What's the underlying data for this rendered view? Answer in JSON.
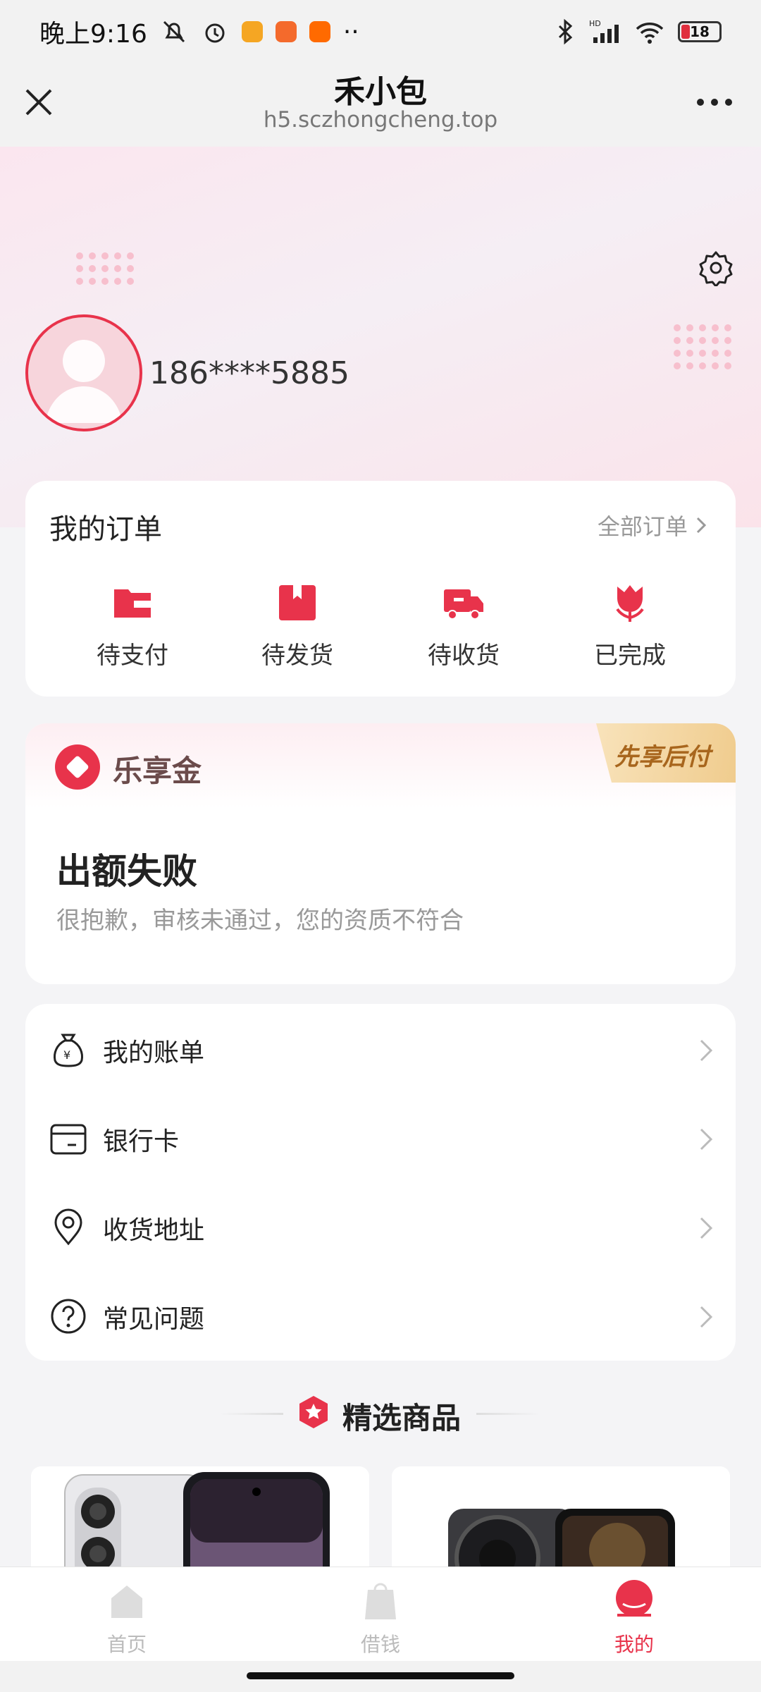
{
  "status_bar": {
    "time": "晚上9:16",
    "network": "HD",
    "battery": "18"
  },
  "nav": {
    "title": "禾小包",
    "url": "h5.sczhongcheng.top"
  },
  "profile": {
    "phone": "186****5885"
  },
  "orders": {
    "title": "我的订单",
    "all_link": "全部订单",
    "items": [
      {
        "label": "待支付",
        "icon": "wallet-icon"
      },
      {
        "label": "待发货",
        "icon": "bookmark-box-icon"
      },
      {
        "label": "待收货",
        "icon": "truck-icon"
      },
      {
        "label": "已完成",
        "icon": "tulip-icon"
      }
    ]
  },
  "credit": {
    "name": "乐享金",
    "tag": "先享后付",
    "status": "出额失败",
    "description": "很抱歉，审核未通过，您的资质不符合"
  },
  "menu": {
    "items": [
      {
        "label": "我的账单",
        "icon": "money-bag-icon"
      },
      {
        "label": "银行卡",
        "icon": "bank-card-icon"
      },
      {
        "label": "收货地址",
        "icon": "location-pin-icon"
      },
      {
        "label": "常见问题",
        "icon": "question-circle-icon"
      }
    ]
  },
  "featured": {
    "title": "精选商品"
  },
  "tabbar": {
    "items": [
      {
        "label": "首页",
        "icon": "home-icon",
        "active": false
      },
      {
        "label": "借钱",
        "icon": "bag-icon",
        "active": false
      },
      {
        "label": "我的",
        "icon": "profile-icon",
        "active": true
      }
    ]
  },
  "colors": {
    "accent": "#e8334b",
    "tag_gold": "#a8661d",
    "background": "#f4f4f6"
  }
}
